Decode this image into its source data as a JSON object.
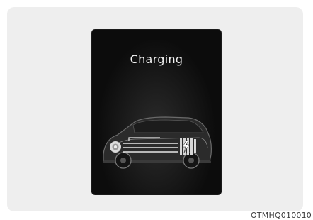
{
  "display": {
    "title": "Charging"
  },
  "illustration": {
    "subject": "car-icon",
    "indicator": "charging-flow-icon",
    "colors": {
      "screen_background": "#0c0c0c",
      "title_text": "#f2f2f2",
      "panel_background": "#eeeeee"
    }
  },
  "caption": {
    "code": "OTMHQ010010"
  }
}
